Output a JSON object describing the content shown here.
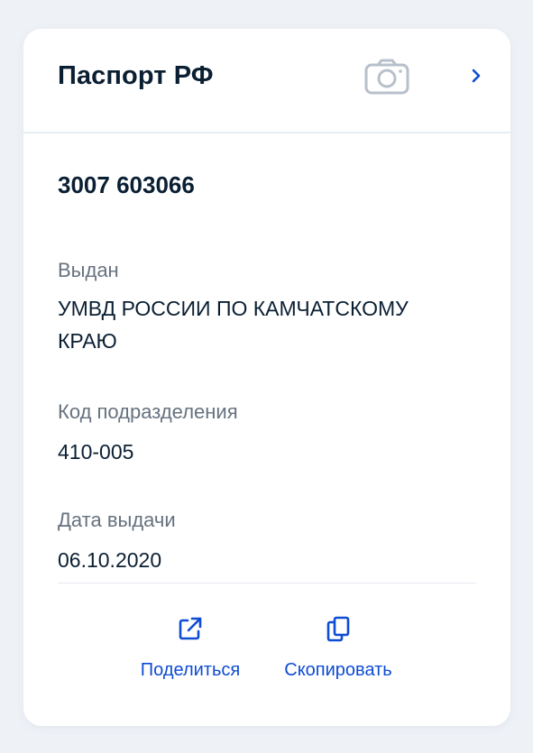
{
  "card": {
    "title": "Паспорт РФ",
    "camera_icon": "camera-icon",
    "chevron_icon": "chevron-right-icon"
  },
  "document": {
    "number": "3007 603066",
    "fields": [
      {
        "label": "Выдан",
        "value": "УМВД РОССИИ ПО КАМЧАТСКОМУ КРАЮ"
      },
      {
        "label": "Код подразделения",
        "value": "410-005"
      },
      {
        "label": "Дата выдачи",
        "value": "06.10.2020"
      }
    ]
  },
  "actions": [
    {
      "label": "Поделиться",
      "icon": "share-icon"
    },
    {
      "label": "Скопировать",
      "icon": "copy-icon"
    }
  ],
  "colors": {
    "accent": "#0d4cd3",
    "text_primary": "#0b1f33",
    "text_secondary": "#66727f",
    "icon_muted": "#b7c0cb",
    "background": "#eef1f6",
    "card": "#ffffff"
  }
}
